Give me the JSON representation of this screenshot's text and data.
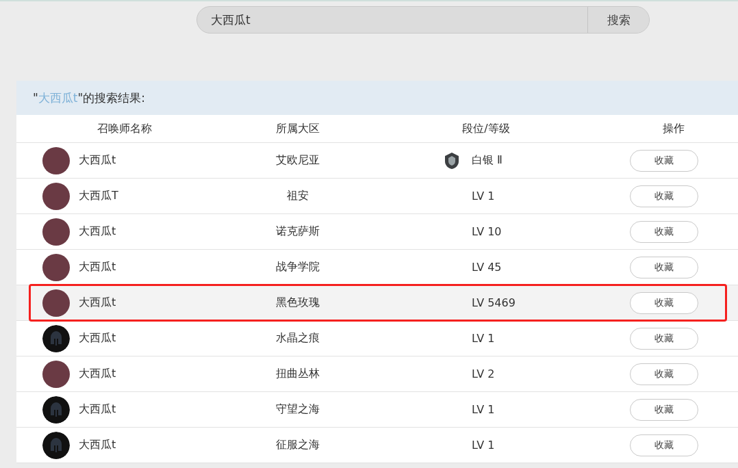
{
  "search": {
    "value": "大西瓜t",
    "button": "搜索"
  },
  "results": {
    "title_before": "\"",
    "title_query": "大西瓜t",
    "title_after": "\"的搜索结果:",
    "columns": [
      "召唤师名称",
      "所属大区",
      "段位/等级",
      "操作"
    ],
    "rows": [
      {
        "avatar": {
          "kind": "picture"
        },
        "name": "大西瓜t",
        "region": "艾欧尼亚",
        "kind": "rank",
        "rank": "白银 Ⅱ",
        "action": "收藏",
        "highlighted": false
      },
      {
        "avatar": {
          "kind": "picture"
        },
        "name": "大西瓜T",
        "region": "祖安",
        "kind": "level",
        "rank": "LV 1",
        "action": "收藏",
        "highlighted": false
      },
      {
        "avatar": {
          "kind": "picture"
        },
        "name": "大西瓜t",
        "region": "诺克萨斯",
        "kind": "level",
        "rank": "LV 10",
        "action": "收藏",
        "highlighted": false
      },
      {
        "avatar": {
          "kind": "picture"
        },
        "name": "大西瓜t",
        "region": "战争学院",
        "kind": "level",
        "rank": "LV 45",
        "action": "收藏",
        "highlighted": false
      },
      {
        "avatar": {
          "kind": "picture"
        },
        "name": "大西瓜t",
        "region": "黑色玫瑰",
        "kind": "level",
        "rank": "LV 5469",
        "action": "收藏",
        "highlighted": true
      },
      {
        "avatar": {
          "kind": "default"
        },
        "name": "大西瓜t",
        "region": "水晶之痕",
        "kind": "level",
        "rank": "LV 1",
        "action": "收藏",
        "highlighted": false
      },
      {
        "avatar": {
          "kind": "picture"
        },
        "name": "大西瓜t",
        "region": "扭曲丛林",
        "kind": "level",
        "rank": "LV 2",
        "action": "收藏",
        "highlighted": false
      },
      {
        "avatar": {
          "kind": "default"
        },
        "name": "大西瓜t",
        "region": "守望之海",
        "kind": "level",
        "rank": "LV 1",
        "action": "收藏",
        "highlighted": false
      },
      {
        "avatar": {
          "kind": "default"
        },
        "name": "大西瓜t",
        "region": "征服之海",
        "kind": "level",
        "rank": "LV 1",
        "action": "收藏",
        "highlighted": false
      }
    ]
  }
}
